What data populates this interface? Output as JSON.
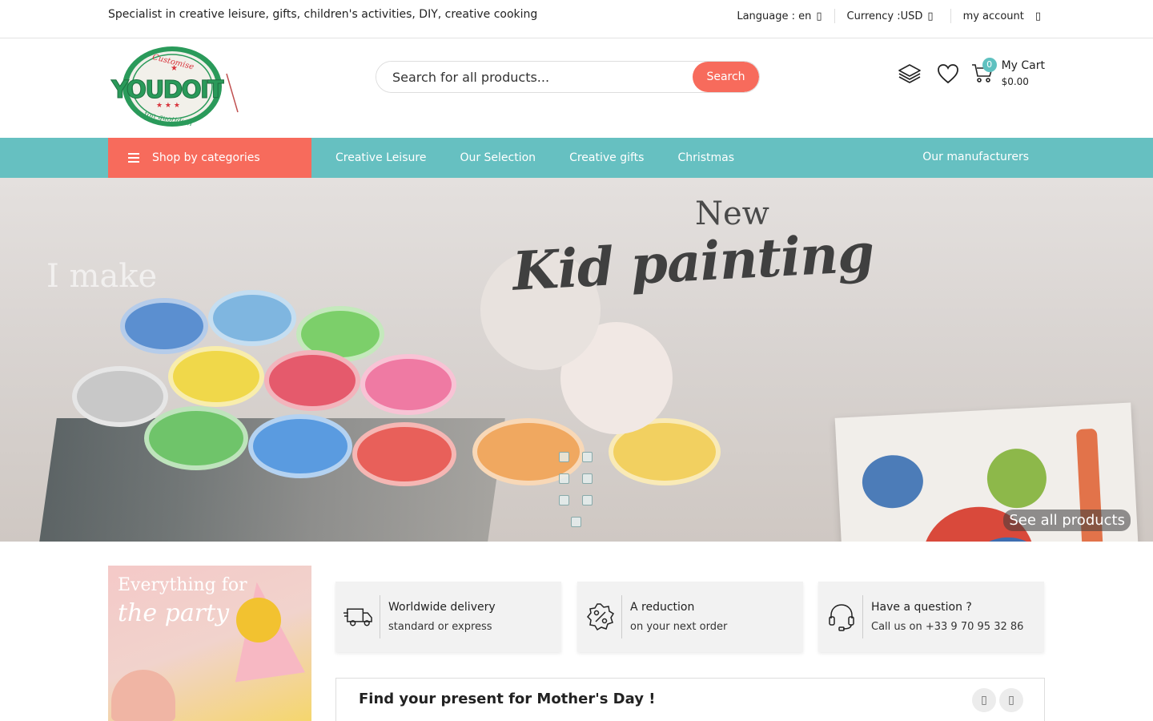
{
  "topbar": {
    "tagline": "Specialist in creative leisure, gifts, children's activities, DIY, creative cooking",
    "language_label": "Language : en",
    "currency_label": "Currency :USD",
    "account_label": "my account"
  },
  "header": {
    "logo_words": {
      "brand": "YOUDOIT",
      "arc_top": "Customise",
      "arc_bottom": "ton quotidien"
    },
    "search_placeholder": "Search for all products...",
    "search_button": "Search",
    "cart": {
      "count": "0",
      "title": "My Cart",
      "total": "$0.00"
    }
  },
  "nav": {
    "categories_button": "Shop by categories",
    "items": [
      "Creative Leisure",
      "Our Selection",
      "Creative gifts",
      "Christmas"
    ],
    "right_item": "Our manufacturers"
  },
  "hero": {
    "title_new": "New",
    "title_main": "Kid painting",
    "faded_text": "I make",
    "cta": "See all products"
  },
  "promo": {
    "line1": "Everything for",
    "line2": "the party"
  },
  "features": [
    {
      "icon": "delivery-truck-icon",
      "title": "Worldwide delivery",
      "subtitle": "standard or express"
    },
    {
      "icon": "discount-badge-icon",
      "title": "A reduction",
      "subtitle": "on your next order"
    },
    {
      "icon": "headset-icon",
      "title": "Have a question ?",
      "subtitle": "Call us on +33 9 70 95 32 86"
    }
  ],
  "mothers_day": {
    "title": "Find your present for Mother's Day !"
  },
  "colors": {
    "accent_coral": "#f76b5c",
    "nav_teal": "#66c0c1",
    "logo_green": "#2a9a5a",
    "logo_red": "#d8343c"
  }
}
